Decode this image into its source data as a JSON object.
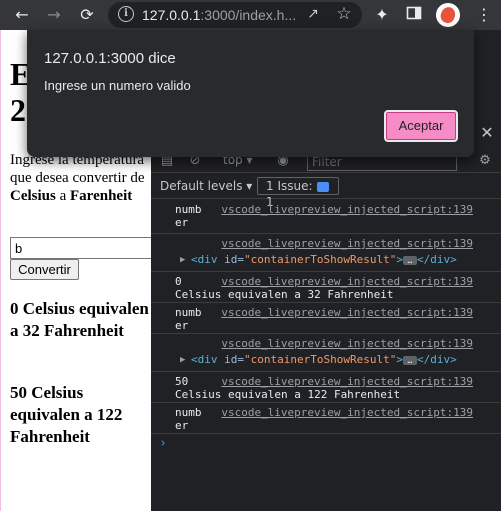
{
  "browser": {
    "url_host": "127.0.0.1",
    "url_rest": ":3000/index.h...",
    "icons": {
      "back": "arrow-left",
      "forward": "arrow-right",
      "reload": "reload",
      "info": "info",
      "share": "share",
      "bookmark": "star",
      "extensions": "puzzle",
      "sidepanel": "side-panel",
      "profile": "avatar",
      "menu": "kebab"
    }
  },
  "page": {
    "heading": "E\n2",
    "prompt_pre": "Ingrese la temperatura que desea convertir de",
    "unit_from": "Celsius",
    "prompt_mid": "a",
    "unit_to": "Farenheit",
    "input_value": "b",
    "convert_label": "Convertir",
    "result1": "0 Celsius equivalen a 32 Fahrenheit",
    "result2": "50 Celsius equivalen a 122 Fahrenheit"
  },
  "devtools": {
    "context": "top",
    "filter_placeholder": "Filter",
    "levels": "Default levels",
    "issues": "1 Issue:",
    "issues_count": "1",
    "source": "vscode_livepreview_injected_script:139",
    "messages": {
      "m1": "numb\ner",
      "m2_tag_open": "<div",
      "m2_attr": "id=",
      "m2_val": "\"containerToShowResult\"",
      "m2_close": "</div>",
      "m3": "0\nCelsius equivalen a 32 Fahrenheit",
      "m4": "numb\ner",
      "m6": "50\nCelsius equivalen a 122 Fahrenheit",
      "m7": "numb\ner"
    },
    "prompt_symbol": "›"
  },
  "dialog": {
    "title": "127.0.0.1:3000 dice",
    "message": "Ingrese un numero valido",
    "ok_label": "Aceptar",
    "accent_color": "#f58cc6"
  }
}
